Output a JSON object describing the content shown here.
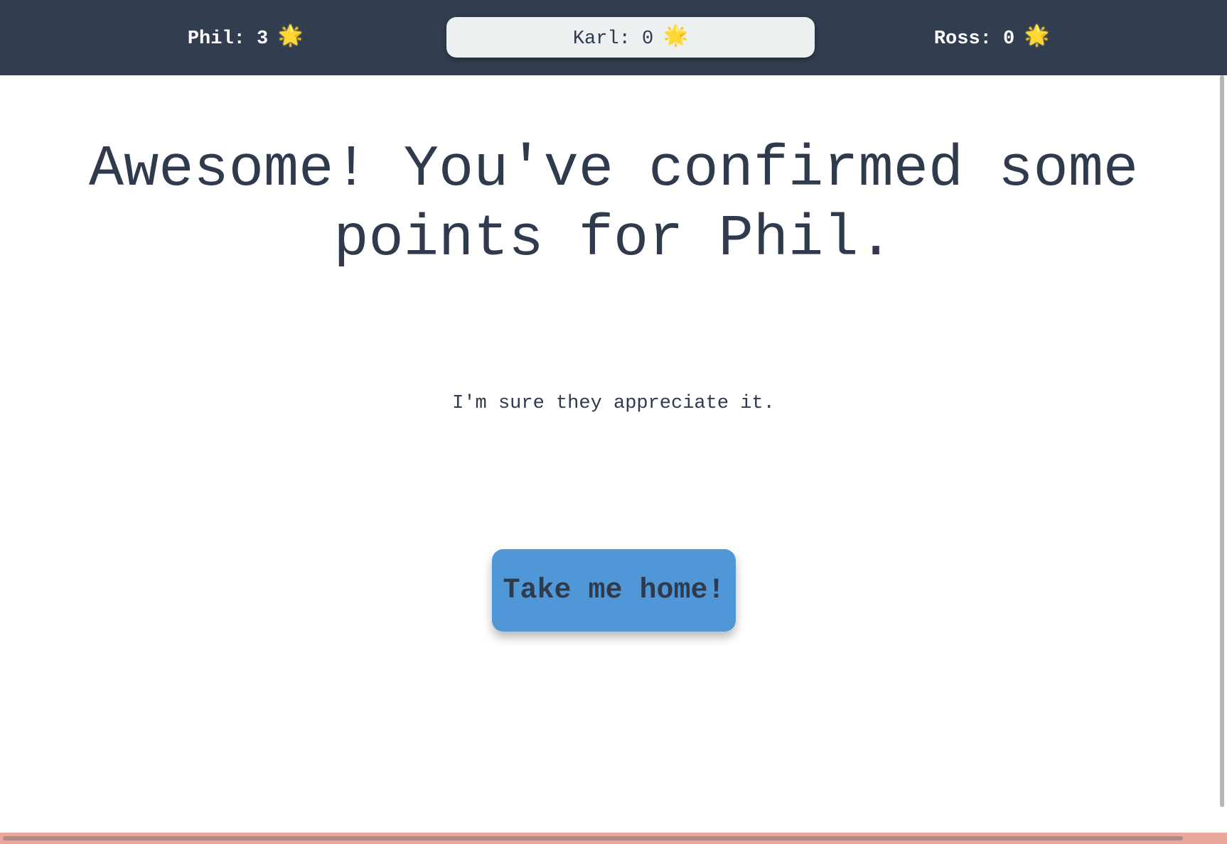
{
  "scoreboard": {
    "players": [
      {
        "label": "Phil: 3",
        "icon": "star-icon"
      },
      {
        "label": "Karl: 0",
        "icon": "star-icon",
        "highlighted": true
      },
      {
        "label": "Ross: 0",
        "icon": "star-icon"
      }
    ],
    "star_glyph": "🌟"
  },
  "main": {
    "headline": "Awesome! You've confirmed some points for Phil.",
    "subtext": "I'm sure they appreciate it.",
    "home_button_label": "Take me home!"
  },
  "colors": {
    "topbar_bg": "#323e50",
    "highlight_bg": "#ecf0f1",
    "text": "#2f3b4d",
    "button_bg": "#5097d7",
    "horizontal_scrollbar_bg": "#eaa89c"
  }
}
